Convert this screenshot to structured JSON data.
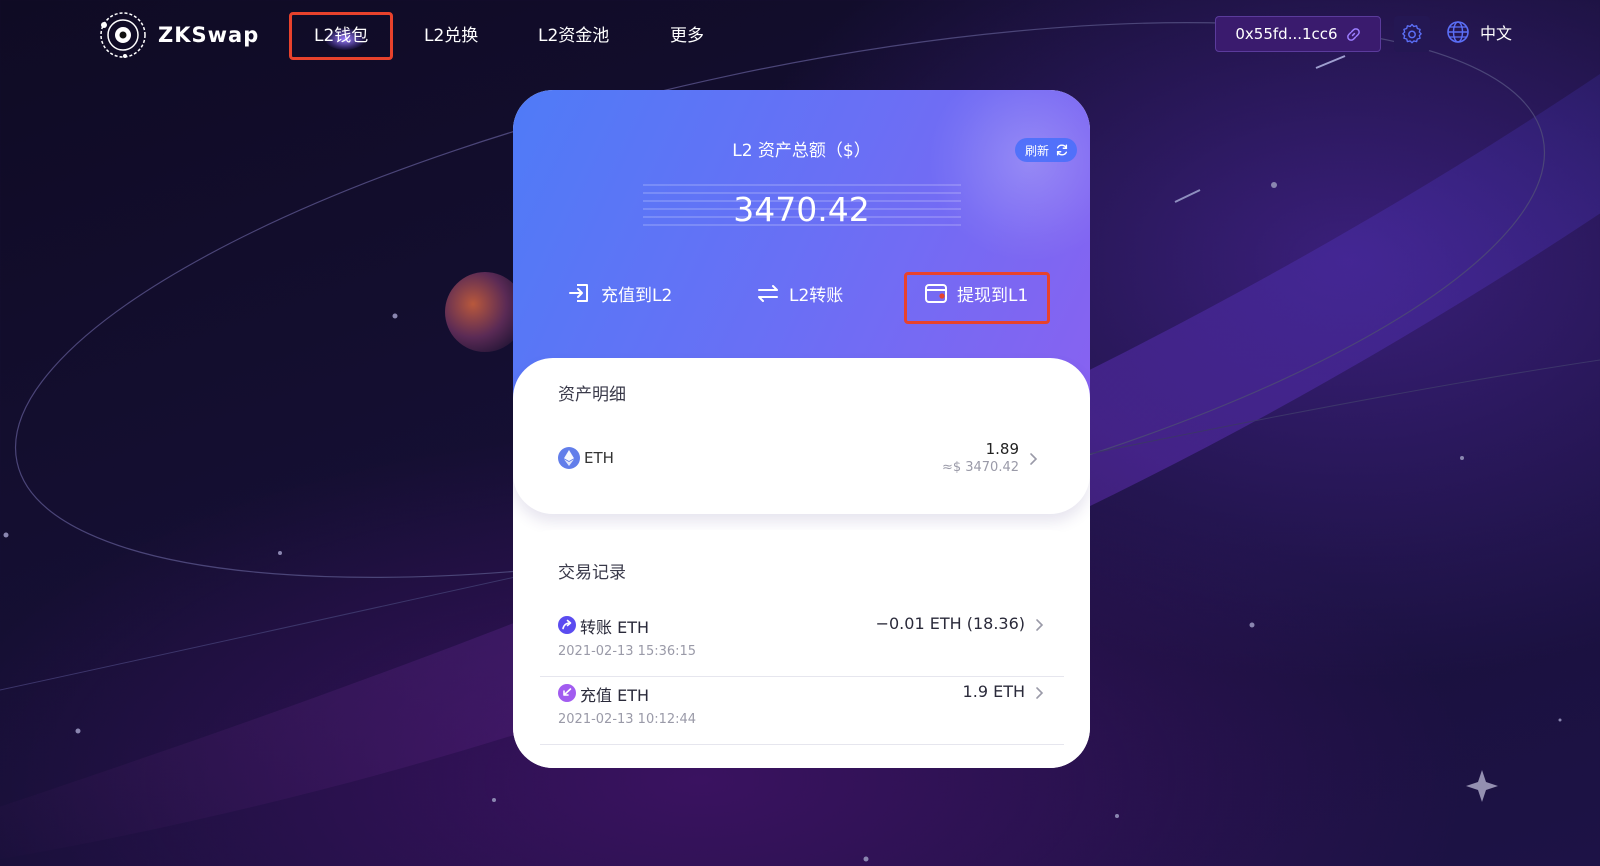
{
  "brand": {
    "name": "ZKSwap"
  },
  "nav": {
    "items": [
      {
        "label": "L2钱包",
        "active": true
      },
      {
        "label": "L2兑换"
      },
      {
        "label": "L2资金池"
      },
      {
        "label": "更多"
      }
    ]
  },
  "account": {
    "address": "0x55fd...1cc6",
    "language": "中文"
  },
  "icons": {
    "logo": "zkswap-logo-icon",
    "address": "link-icon",
    "settings": "gear-icon",
    "language": "globe-icon",
    "refresh": "refresh-icon",
    "deposit": "deposit-icon",
    "transfer": "transfer-icon",
    "withdraw": "wallet-icon",
    "token": "eth-icon",
    "chevron": "chevron-right-icon"
  },
  "colors": {
    "accent_start": "#4f7bf7",
    "accent_end": "#8a61f0",
    "highlight_box": "#e8422c"
  },
  "summary": {
    "title": "L2 资产总额（$）",
    "refresh_label": "刷新",
    "total": "3470.42"
  },
  "actions": {
    "deposit": "充值到L2",
    "transfer": "L2转账",
    "withdraw": "提现到L1"
  },
  "assets": {
    "title": "资产明细",
    "items": [
      {
        "symbol": "ETH",
        "amount": "1.89",
        "usd": "≈$ 3470.42"
      }
    ]
  },
  "transactions": {
    "title": "交易记录",
    "items": [
      {
        "type": "转账 ETH",
        "amount": "−0.01 ETH (18.36)",
        "time": "2021-02-13 15:36:15"
      },
      {
        "type": "充值 ETH",
        "amount": "1.9 ETH",
        "time": "2021-02-13 10:12:44"
      }
    ]
  }
}
